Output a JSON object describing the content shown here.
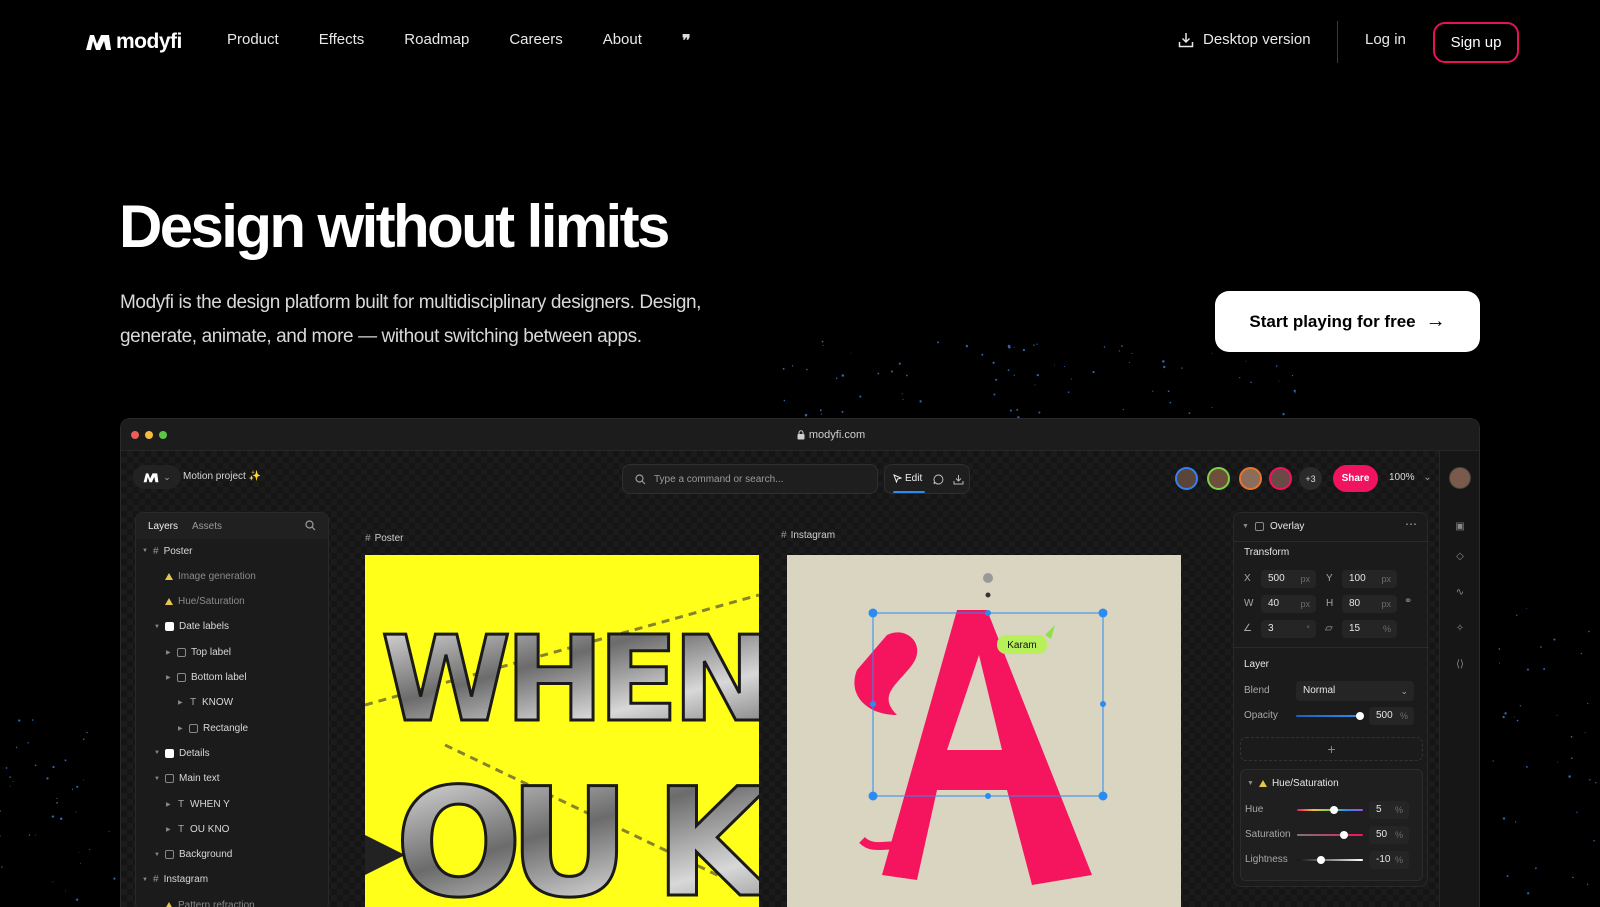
{
  "nav": {
    "logo_text": "modyfi",
    "links": [
      "Product",
      "Effects",
      "Roadmap",
      "Careers",
      "About"
    ],
    "quote_glyph": "❞",
    "desktop_label": "Desktop version",
    "login_label": "Log in",
    "signup_label": "Sign up"
  },
  "hero": {
    "title": "Design without limits",
    "subtitle": "Modyfi is the design platform built for multidisciplinary designers. Design, generate, animate, and more — without switching between apps.",
    "cta_label": "Start playing for free",
    "cta_arrow": "→"
  },
  "app": {
    "url": "modyfi.com",
    "project_name": "Motion project",
    "project_sparkle": "✨",
    "command_placeholder": "Type a command or search...",
    "edit_label": "Edit",
    "extra_collaborators": "+3",
    "share_label": "Share",
    "zoom": "100%",
    "collaborator_colors": [
      "#3a7ff0",
      "#7fd14a",
      "#e8752f",
      "#f0135f"
    ],
    "layers_panel": {
      "tabs": [
        "Layers",
        "Assets"
      ],
      "items": [
        {
          "label": "Poster",
          "icon": "frame-icon",
          "level": 0
        },
        {
          "label": "Image generation",
          "icon": "effect-icon",
          "level": 1,
          "dim": true
        },
        {
          "label": "Hue/Saturation",
          "icon": "effect-icon",
          "level": 1,
          "dim": true
        },
        {
          "label": "Date labels",
          "icon": "group-icon",
          "level": 1
        },
        {
          "label": "Top label",
          "icon": "layer-icon",
          "level": 2
        },
        {
          "label": "Bottom label",
          "icon": "layer-icon",
          "level": 2
        },
        {
          "label": "KNOW",
          "icon": "text-icon",
          "level": 3
        },
        {
          "label": "Rectangle",
          "icon": "rectangle-icon",
          "level": 3
        },
        {
          "label": "Details",
          "icon": "group-icon",
          "level": 1
        },
        {
          "label": "Main text",
          "icon": "layer-icon",
          "level": 1
        },
        {
          "label": "WHEN Y",
          "icon": "text-icon",
          "level": 2
        },
        {
          "label": "OU KNO",
          "icon": "text-icon",
          "level": 2
        },
        {
          "label": "Background",
          "icon": "layer-icon",
          "level": 1
        },
        {
          "label": "Instagram",
          "icon": "frame-icon",
          "level": 0
        },
        {
          "label": "Pattern refraction",
          "icon": "effect-icon",
          "level": 1,
          "dim": true
        }
      ]
    },
    "frames": {
      "poster_label": "Poster",
      "poster_text_top": "WHEN Y",
      "poster_text_bottom": "OU KNO",
      "instagram_label": "Instagram",
      "instagram_letter": "A",
      "cursor_name": "Karam"
    },
    "properties": {
      "layer_name": "Overlay",
      "transform_title": "Transform",
      "x_label": "X",
      "x_value": "500",
      "y_label": "Y",
      "y_value": "100",
      "w_label": "W",
      "w_value": "40",
      "h_label": "H",
      "h_value": "80",
      "rotation_value": "3",
      "skew_value": "15",
      "unit_px": "px",
      "unit_deg": "°",
      "unit_pct": "%",
      "layer_title": "Layer",
      "blend_label": "Blend",
      "blend_value": "Normal",
      "opacity_label": "Opacity",
      "opacity_value": "500",
      "add_symbol": "+",
      "effect_title": "Hue/Saturation",
      "hue_label": "Hue",
      "hue_value": "5",
      "saturation_label": "Saturation",
      "saturation_value": "50",
      "lightness_label": "Lightness",
      "lightness_value": "-10"
    }
  }
}
